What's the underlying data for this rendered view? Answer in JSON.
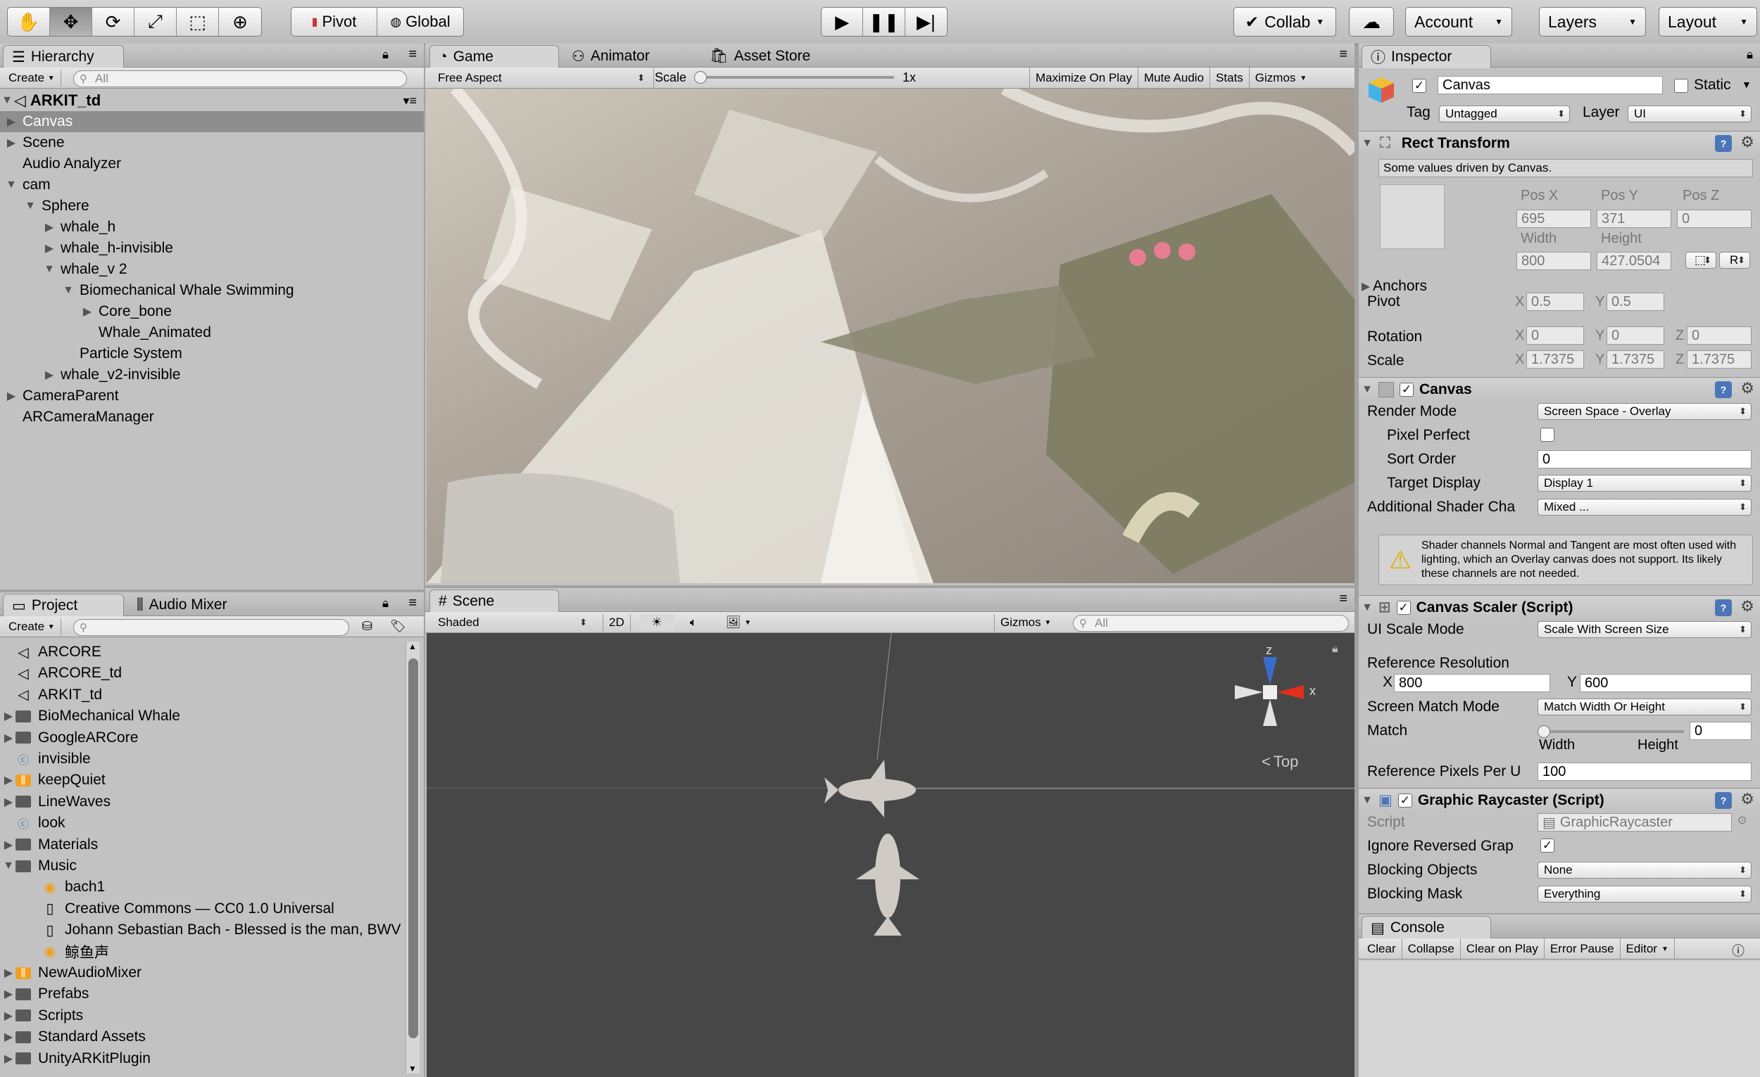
{
  "toolbar": {
    "tools": [
      {
        "icon": "hand-icon",
        "glyph": "✋"
      },
      {
        "icon": "move-icon",
        "glyph": "✥"
      },
      {
        "icon": "rotate-icon",
        "glyph": "⟳"
      },
      {
        "icon": "scale-icon",
        "glyph": "⤢"
      },
      {
        "icon": "rect-icon",
        "glyph": "⬚"
      },
      {
        "icon": "transform-icon",
        "glyph": "⊕"
      }
    ],
    "pivot": "Pivot",
    "global": "Global",
    "collab": "Collab",
    "account": "Account",
    "layers": "Layers",
    "layout": "Layout"
  },
  "hierarchy": {
    "tab": "Hierarchy",
    "create": "Create",
    "search_placeholder": "All",
    "scene_name": "ARKIT_td",
    "items": [
      {
        "label": "Canvas",
        "depth": 1,
        "expander": "▶",
        "selected": true
      },
      {
        "label": "Scene",
        "depth": 1,
        "expander": "▶"
      },
      {
        "label": "Audio Analyzer",
        "depth": 1,
        "expander": ""
      },
      {
        "label": "cam",
        "depth": 1,
        "expander": "▼"
      },
      {
        "label": "Sphere",
        "depth": 2,
        "expander": "▼"
      },
      {
        "label": "whale_h",
        "depth": 3,
        "expander": "▶"
      },
      {
        "label": "whale_h-invisible",
        "depth": 3,
        "expander": "▶"
      },
      {
        "label": "whale_v 2",
        "depth": 3,
        "expander": "▼"
      },
      {
        "label": "Biomechanical Whale Swimming",
        "depth": 4,
        "expander": "▼"
      },
      {
        "label": "Core_bone",
        "depth": 5,
        "expander": "▶"
      },
      {
        "label": "Whale_Animated",
        "depth": 5,
        "expander": ""
      },
      {
        "label": "Particle System",
        "depth": 4,
        "expander": ""
      },
      {
        "label": "whale_v2-invisible",
        "depth": 3,
        "expander": "▶"
      },
      {
        "label": "CameraParent",
        "depth": 1,
        "expander": "▶"
      },
      {
        "label": "ARCameraManager",
        "depth": 1,
        "expander": ""
      }
    ]
  },
  "game": {
    "tabs": [
      "Game",
      "Animator",
      "Asset Store"
    ],
    "aspect": "Free Aspect",
    "scale_label": "Scale",
    "scale_value": "1x",
    "buttons": [
      "Maximize On Play",
      "Mute Audio",
      "Stats",
      "Gizmos"
    ]
  },
  "scene": {
    "tab": "Scene",
    "shading": "Shaded",
    "mode_2d": "2D",
    "gizmos": "Gizmos",
    "search_placeholder": "All",
    "orientation": "Top",
    "axes": {
      "z": "z",
      "x": "x"
    }
  },
  "project": {
    "tabs": [
      "Project",
      "Audio Mixer"
    ],
    "create": "Create",
    "items": [
      {
        "label": "ARCORE",
        "kind": "unity",
        "expander": "",
        "indent": 0
      },
      {
        "label": "ARCORE_td",
        "kind": "unity",
        "expander": "",
        "indent": 0
      },
      {
        "label": "ARKIT_td",
        "kind": "unity",
        "expander": "",
        "indent": 0
      },
      {
        "label": "BioMechanical Whale",
        "kind": "folder",
        "expander": "▶",
        "indent": 0
      },
      {
        "label": "GoogleARCore",
        "kind": "folder",
        "expander": "▶",
        "indent": 0
      },
      {
        "label": "invisible",
        "kind": "script",
        "expander": "",
        "indent": 0
      },
      {
        "label": "keepQuiet",
        "kind": "mixer",
        "expander": "▶",
        "indent": 0
      },
      {
        "label": "LineWaves",
        "kind": "folder",
        "expander": "▶",
        "indent": 0
      },
      {
        "label": "look",
        "kind": "script",
        "expander": "",
        "indent": 0
      },
      {
        "label": "Materials",
        "kind": "folder",
        "expander": "▶",
        "indent": 0
      },
      {
        "label": "Music",
        "kind": "folder",
        "expander": "▼",
        "indent": 0
      },
      {
        "label": "bach1",
        "kind": "audio",
        "expander": "",
        "indent": 1
      },
      {
        "label": "Creative Commons — CC0 1.0 Universal",
        "kind": "doc",
        "expander": "",
        "indent": 1
      },
      {
        "label": "Johann Sebastian Bach - Blessed is the man, BWV",
        "kind": "doc",
        "expander": "",
        "indent": 1
      },
      {
        "label": "鲸鱼声",
        "kind": "audio",
        "expander": "",
        "indent": 1
      },
      {
        "label": "NewAudioMixer",
        "kind": "mixer",
        "expander": "▶",
        "indent": 0
      },
      {
        "label": "Prefabs",
        "kind": "folder",
        "expander": "▶",
        "indent": 0
      },
      {
        "label": "Scripts",
        "kind": "folder",
        "expander": "▶",
        "indent": 0
      },
      {
        "label": "Standard Assets",
        "kind": "folder",
        "expander": "▶",
        "indent": 0
      },
      {
        "label": "UnityARKitPlugin",
        "kind": "folder",
        "expander": "▶",
        "indent": 0
      }
    ]
  },
  "inspector": {
    "tab": "Inspector",
    "object_name": "Canvas",
    "static_label": "Static",
    "tag_label": "Tag",
    "tag_value": "Untagged",
    "layer_label": "Layer",
    "layer_value": "UI",
    "rect": {
      "title": "Rect Transform",
      "note": "Some values driven by Canvas.",
      "pos_x_label": "Pos X",
      "pos_y_label": "Pos Y",
      "pos_z_label": "Pos Z",
      "pos_x": "695",
      "pos_y": "371",
      "pos_z": "0",
      "width_label": "Width",
      "height_label": "Height",
      "width": "800",
      "height": "427.0504",
      "r_button": "R",
      "anchors": "Anchors",
      "pivot": "Pivot",
      "pivot_x": "0.5",
      "pivot_y": "0.5",
      "rotation": "Rotation",
      "rot_x": "0",
      "rot_y": "0",
      "rot_z": "0",
      "scale": "Scale",
      "scale_x": "1.7375",
      "scale_y": "1.7375",
      "scale_z": "1.7375",
      "x": "X",
      "y": "Y",
      "z": "Z"
    },
    "canvas": {
      "title": "Canvas",
      "render_mode_label": "Render Mode",
      "render_mode": "Screen Space - Overlay",
      "pixel_perfect": "Pixel Perfect",
      "sort_order_label": "Sort Order",
      "sort_order": "0",
      "target_display_label": "Target Display",
      "target_display": "Display 1",
      "shader_label": "Additional Shader Cha",
      "shader_value": "Mixed ...",
      "warning": "Shader channels Normal and Tangent are most often used with lighting, which an Overlay canvas does not support. Its likely these channels are not needed."
    },
    "scaler": {
      "title": "Canvas Scaler (Script)",
      "ui_scale_label": "UI Scale Mode",
      "ui_scale": "Scale With Screen Size",
      "ref_res": "Reference Resolution",
      "ref_x": "800",
      "ref_y": "600",
      "match_mode_label": "Screen Match Mode",
      "match_mode": "Match Width Or Height",
      "match_label": "Match",
      "match_value": "0",
      "width_word": "Width",
      "height_word": "Height",
      "ref_ppu_label": "Reference Pixels Per U",
      "ref_ppu": "100"
    },
    "raycaster": {
      "title": "Graphic Raycaster (Script)",
      "script_label": "Script",
      "script_value": "GraphicRaycaster",
      "ignore_label": "Ignore Reversed Grap",
      "blocking_objects_label": "Blocking Objects",
      "blocking_objects": "None",
      "blocking_mask_label": "Blocking Mask",
      "blocking_mask": "Everything"
    }
  },
  "console": {
    "tab": "Console",
    "buttons": [
      "Clear",
      "Collapse",
      "Clear on Play",
      "Error Pause",
      "Editor"
    ]
  },
  "colors": {
    "accent_blue": "#3a6ccf",
    "warning_yellow": "#f2c200",
    "selection": "#8e8e8e",
    "scene_bg": "#474747"
  }
}
